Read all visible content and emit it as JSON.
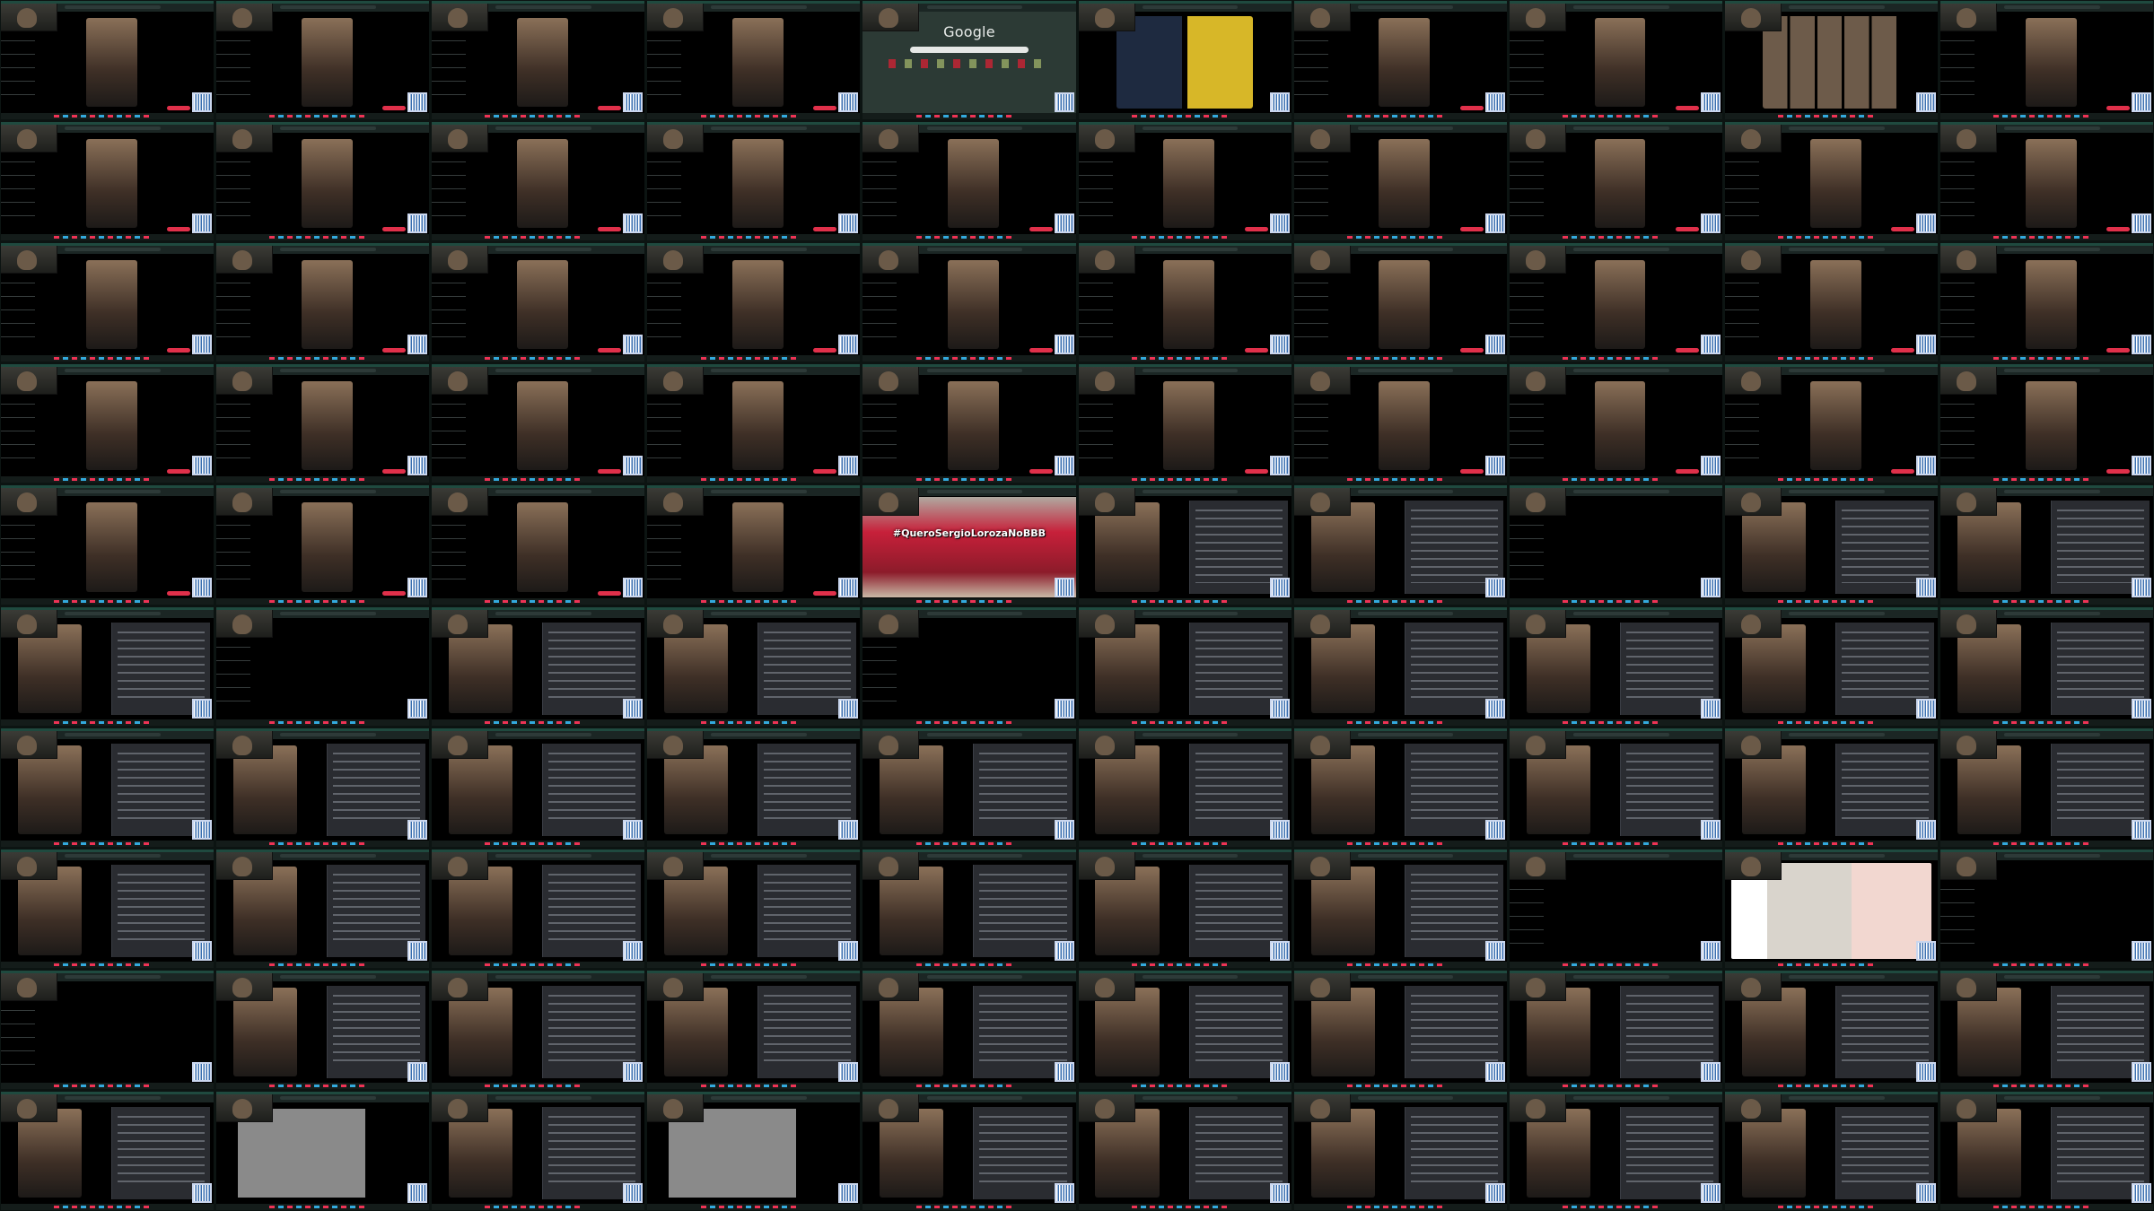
{
  "grid": {
    "rows": 10,
    "columns": 10
  },
  "colors": {
    "frame_accent": "#1f4a3f",
    "chat_panel": "#2a2c31",
    "live_red": "#e0304a",
    "qr_blue": "#3a6fb0"
  },
  "texts": {
    "google_logo": "Google",
    "banner_caption": "#QueroSergioLorozaNoBBB"
  },
  "tiles": [
    "stream",
    "stream",
    "stream",
    "stream",
    "google",
    "yt",
    "stream",
    "stream",
    "ytgrid",
    "stream",
    "stream",
    "stream",
    "stream",
    "stream",
    "stream",
    "stream",
    "stream",
    "stream",
    "stream",
    "stream",
    "stream",
    "stream",
    "stream",
    "stream",
    "stream",
    "stream",
    "stream",
    "stream",
    "stream",
    "stream",
    "stream",
    "stream",
    "stream",
    "stream",
    "stream",
    "stream",
    "stream",
    "stream",
    "stream",
    "stream",
    "stream",
    "stream",
    "stream",
    "stream",
    "banner",
    "comments",
    "comments",
    "dark",
    "comments",
    "comments",
    "comments",
    "dark",
    "comments",
    "comments",
    "dark",
    "comments",
    "comments",
    "comments",
    "comments",
    "comments",
    "comments",
    "comments",
    "comments",
    "comments",
    "comments",
    "comments",
    "comments",
    "comments",
    "comments",
    "comments",
    "comments",
    "comments",
    "comments",
    "comments",
    "comments",
    "comments",
    "comments",
    "dark",
    "tiktokapp",
    "dark",
    "dark",
    "comments",
    "comments",
    "comments",
    "comments",
    "comments",
    "comments",
    "comments",
    "comments",
    "comments",
    "comments",
    "gray",
    "comments",
    "gray",
    "comments",
    "comments",
    "comments",
    "comments",
    "comments",
    "comments"
  ]
}
